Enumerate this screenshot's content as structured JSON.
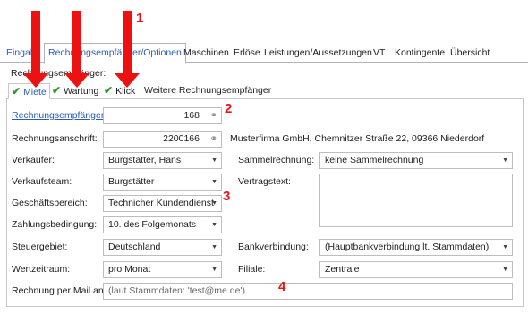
{
  "tabs": [
    {
      "label": "Eingabe"
    },
    {
      "label": "Rechnungsempfänger/Optionen"
    },
    {
      "label": "Maschinen"
    },
    {
      "label": "Erlöse"
    },
    {
      "label": "Leistungen/Aussetzungen"
    },
    {
      "label": "VT"
    },
    {
      "label": "Kontingente"
    },
    {
      "label": "Übersicht"
    }
  ],
  "section_label": "Rechnungsempfänger:",
  "subtabs": [
    {
      "label": "Miete",
      "checked": true
    },
    {
      "label": "Wartung",
      "checked": true
    },
    {
      "label": "Klick",
      "checked": true
    },
    {
      "label": "Weitere Rechnungsempfänger",
      "checked": false
    }
  ],
  "form": {
    "rechnungsempfaenger_label": "Rechnungsempfänger",
    "rechnungsempfaenger_value": "168",
    "rechnungsanschrift_label": "Rechnungsanschrift:",
    "rechnungsanschrift_value": "2200166",
    "rechnungsanschrift_text": "Musterfirma GmbH, Chemnitzer Straße 22, 09366 Niederdorf",
    "verkaeufer_label": "Verkäufer:",
    "verkaeufer_value": "Burgstätter, Hans",
    "sammelrechnung_label": "Sammelrechnung:",
    "sammelrechnung_value": "keine Sammelrechnung",
    "verkaufsteam_label": "Verkaufsteam:",
    "verkaufsteam_value": "Burgstätter",
    "vertragstext_label": "Vertragstext:",
    "geschaeftsbereich_label": "Geschäftsbereich:",
    "geschaeftsbereich_value": "Technicher Kundendienst",
    "zahlungsbedingung_label": "Zahlungsbedingung:",
    "zahlungsbedingung_value": "10. des Folgemonats",
    "steuergebiet_label": "Steuergebiet:",
    "steuergebiet_value": "Deutschland",
    "bankverbindung_label": "Bankverbindung:",
    "bankverbindung_value": "(Hauptbankverbindung lt. Stammdaten)",
    "wertzeitraum_label": "Wertzeitraum:",
    "wertzeitraum_value": "pro Monat",
    "filiale_label": "Filiale:",
    "filiale_value": "Zentrale",
    "mail_label": "Rechnung per Mail an:",
    "mail_placeholder": "(laut Stammdaten: 'test@me.de')"
  },
  "markers": {
    "m1": "1",
    "m2": "2",
    "m3": "3",
    "m4": "4"
  },
  "colors": {
    "accent": "#2a5db5",
    "check": "#2e9a2e",
    "annotation": "#ee1111"
  }
}
